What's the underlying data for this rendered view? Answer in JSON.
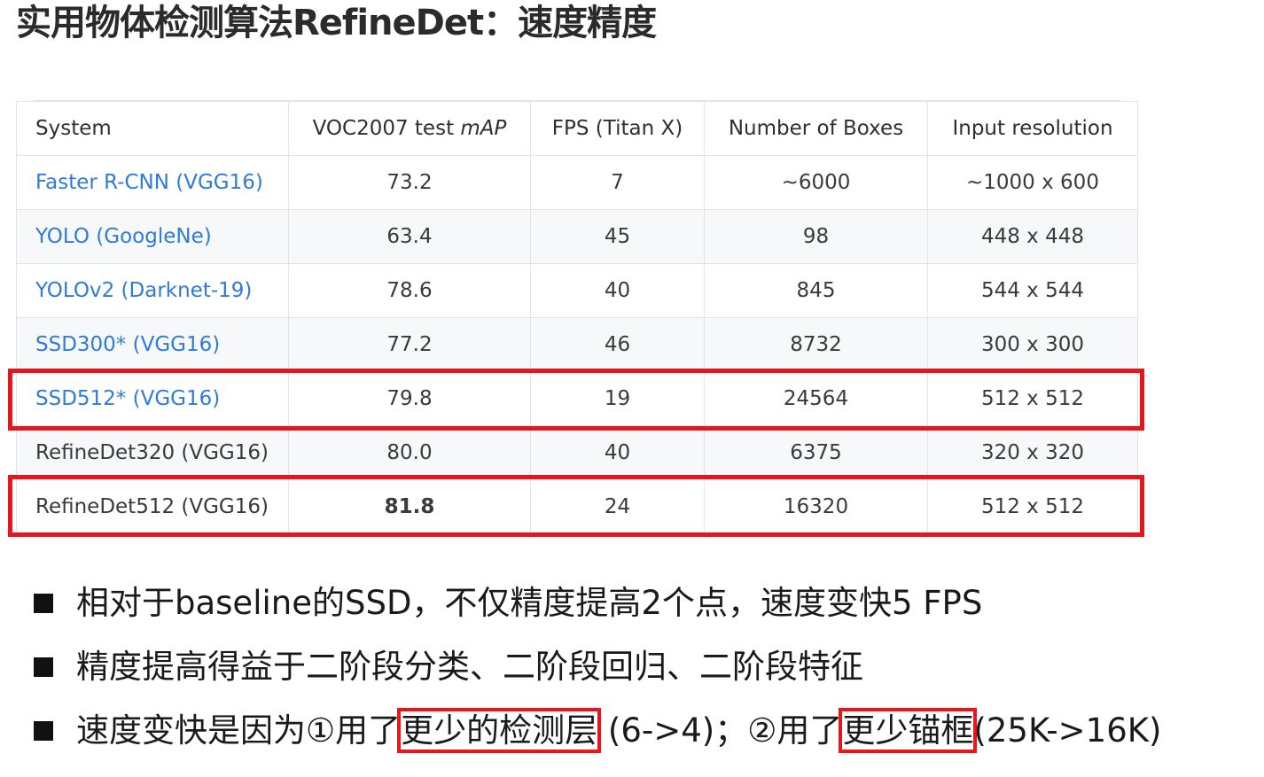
{
  "title": "实用物体检测算法RefineDet：速度精度",
  "table": {
    "headers": [
      "System",
      "VOC2007 test mAP",
      "FPS (Titan X)",
      "Number of Boxes",
      "Input resolution"
    ],
    "rows": [
      {
        "system": "Faster R-CNN (VGG16)",
        "map": "73.2",
        "fps": "7",
        "boxes": "~6000",
        "res": "~1000 x 600"
      },
      {
        "system": "YOLO (GoogleNe)",
        "map": "63.4",
        "fps": "45",
        "boxes": "98",
        "res": "448 x 448"
      },
      {
        "system": "YOLOv2 (Darknet-19)",
        "map": "78.6",
        "fps": "40",
        "boxes": "845",
        "res": "544 x 544"
      },
      {
        "system": "SSD300* (VGG16)",
        "map": "77.2",
        "fps": "46",
        "boxes": "8732",
        "res": "300 x 300"
      },
      {
        "system": "SSD512* (VGG16)",
        "map": "79.8",
        "fps": "19",
        "boxes": "24564",
        "res": "512 x 512"
      },
      {
        "system": "RefineDet320 (VGG16)",
        "map": "80.0",
        "fps": "40",
        "boxes": "6375",
        "res": "320 x 320"
      },
      {
        "system": "RefineDet512 (VGG16)",
        "map": "81.8",
        "fps": "24",
        "boxes": "16320",
        "res": "512 x 512"
      }
    ]
  },
  "bullets": {
    "b1": "相对于baseline的SSD，不仅精度提高2个点，速度变快5 FPS",
    "b2": "精度提高得益于二阶段分类、二阶段回归、二阶段特征",
    "b3": {
      "p1": "速度变快是因为①用了",
      "p2": "更少的检测层",
      "p3": " (6->4)；②用了",
      "p4": "更少锚框",
      "p5": "(25K->16K)"
    }
  },
  "colors": {
    "link": "#2f7bd8",
    "highlight": "#e8151b"
  }
}
